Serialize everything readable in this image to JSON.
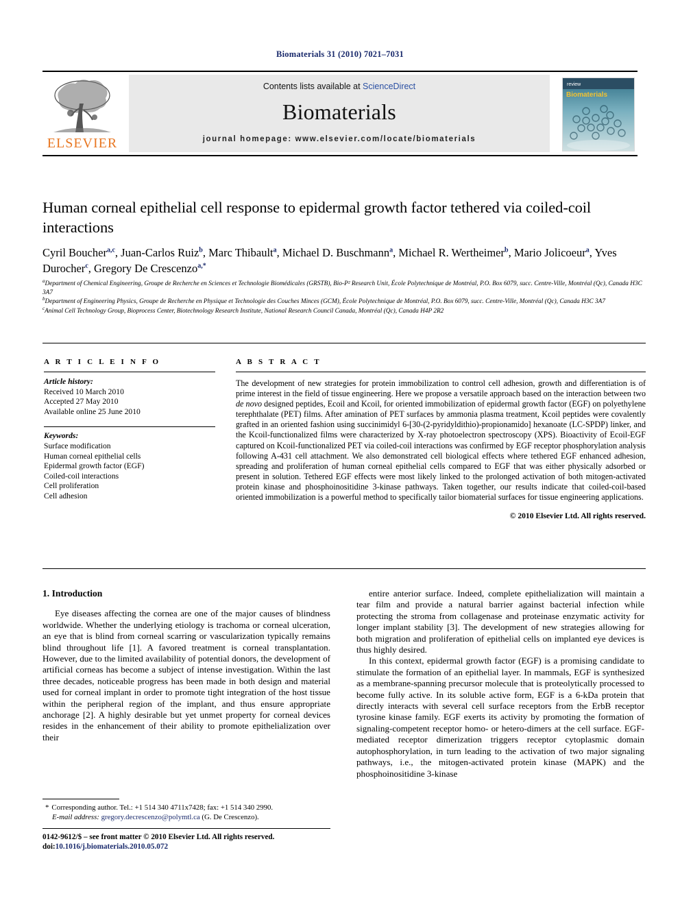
{
  "running_head": "Biomaterials 31 (2010) 7021–7031",
  "masthead": {
    "publisher_name": "ELSEVIER",
    "contents_prefix": "Contents lists available at ",
    "contents_link": "ScienceDirect",
    "journal_name": "Biomaterials",
    "homepage_label": "journal homepage: www.elsevier.com/locate/biomaterials",
    "cover_title": "Biomaterials",
    "link_color": "#2a4fa2",
    "brand_color": "#E87722"
  },
  "article": {
    "title": "Human corneal epithelial cell response to epidermal growth factor tethered via coiled-coil interactions",
    "authors_line1": "Cyril Boucher",
    "authors": [
      {
        "name": "Cyril Boucher",
        "sup": "a,c"
      },
      {
        "name": "Juan-Carlos Ruiz",
        "sup": "b"
      },
      {
        "name": "Marc Thibault",
        "sup": "a"
      },
      {
        "name": "Michael D. Buschmann",
        "sup": "a"
      },
      {
        "name": "Michael R. Wertheimer",
        "sup": "b"
      },
      {
        "name": "Mario Jolicoeur",
        "sup": "a"
      },
      {
        "name": "Yves Durocher",
        "sup": "c"
      },
      {
        "name": "Gregory De Crescenzo",
        "sup": "a,*"
      }
    ],
    "affiliations": [
      {
        "marker": "a",
        "text": "Department of Chemical Engineering, Groupe de Recherche en Sciences et Technologie Biomédicales (GRSTB), Bio-P² Research Unit, École Polytechnique de Montréal, P.O. Box 6079, succ. Centre-Ville, Montréal (Qc), Canada H3C 3A7"
      },
      {
        "marker": "b",
        "text": "Department of Engineering Physics, Groupe de Recherche en Physique et Technologie des Couches Minces (GCM), École Polytechnique de Montréal, P.O. Box 6079, succ. Centre-Ville, Montréal (Qc), Canada H3C 3A7"
      },
      {
        "marker": "c",
        "text": "Animal Cell Technology Group, Bioprocess Center, Biotechnology Research Institute, National Research Council Canada, Montréal (Qc), Canada H4P 2R2"
      }
    ]
  },
  "article_info": {
    "heading": "A R T I C L E   I N F O",
    "history_label": "Article history:",
    "history": [
      "Received 10 March 2010",
      "Accepted 27 May 2010",
      "Available online 25 June 2010"
    ],
    "keywords_label": "Keywords:",
    "keywords": [
      "Surface modification",
      "Human corneal epithelial cells",
      "Epidermal growth factor (EGF)",
      "Coiled-coil interactions",
      "Cell proliferation",
      "Cell adhesion"
    ]
  },
  "abstract": {
    "heading": "A B S T R A C T",
    "part1": "The development of new strategies for protein immobilization to control cell adhesion, growth and differentiation is of prime interest in the field of tissue engineering. Here we propose a versatile approach based on the interaction between two ",
    "italic1": "de novo",
    "part2": " designed peptides, Ecoil and Kcoil, for oriented immobilization of epidermal growth factor (EGF) on polyethylene terephthalate (PET) films. After amination of PET surfaces by ammonia plasma treatment, Kcoil peptides were covalently grafted in an oriented fashion using succinimidyl 6-[30-(2-pyridyldithio)-propionamido] hexanoate (LC-SPDP) linker, and the Kcoil-functionalized films were characterized by X-ray photoelectron spectroscopy (XPS). Bioactivity of Ecoil-EGF captured on Kcoil-functionalized PET via coiled-coil interactions was confirmed by EGF receptor phosphorylation analysis following A-431 cell attachment. We also demonstrated cell biological effects where tethered EGF enhanced adhesion, spreading and proliferation of human corneal epithelial cells compared to EGF that was either physically adsorbed or present in solution. Tethered EGF effects were most likely linked to the prolonged activation of both mitogen-activated protein kinase and phosphoinositidine 3-kinase pathways. Taken together, our results indicate that coiled-coil-based oriented immobilization is a powerful method to specifically tailor biomaterial surfaces for tissue engineering applications.",
    "copyright": "© 2010 Elsevier Ltd. All rights reserved."
  },
  "introduction": {
    "section_number_title": "1. Introduction",
    "left_paragraphs": [
      "Eye diseases affecting the cornea are one of the major causes of blindness worldwide. Whether the underlying etiology is trachoma or corneal ulceration, an eye that is blind from corneal scarring or vascularization typically remains blind throughout life [1]. A favored treatment is corneal transplantation. However, due to the limited availability of potential donors, the development of artificial corneas has become a subject of intense investigation. Within the last three decades, noticeable progress has been made in both design and material used for corneal implant in order to promote tight integration of the host tissue within the peripheral region of the implant, and thus ensure appropriate anchorage [2]. A highly desirable but yet unmet property for corneal devices resides in the enhancement of their ability to promote epithelialization over their"
    ],
    "right_paragraphs": [
      "entire anterior surface. Indeed, complete epithelialization will maintain a tear film and provide a natural barrier against bacterial infection while protecting the stroma from collagenase and proteinase enzymatic activity for longer implant stability [3]. The development of new strategies allowing for both migration and proliferation of epithelial cells on implanted eye devices is thus highly desired.",
      "In this context, epidermal growth factor (EGF) is a promising candidate to stimulate the formation of an epithelial layer. In mammals, EGF is synthesized as a membrane-spanning precursor molecule that is proteolytically processed to become fully active. In its soluble active form, EGF is a 6-kDa protein that directly interacts with several cell surface receptors from the ErbB receptor tyrosine kinase family. EGF exerts its activity by promoting the formation of signaling-competent receptor homo- or hetero-dimers at the cell surface. EGF-mediated receptor dimerization triggers receptor cytoplasmic domain autophosphorylation, in turn leading to the activation of two major signaling pathways, i.e., the mitogen-activated protein kinase (MAPK) and the phosphoinositidine 3-kinase"
    ]
  },
  "footnote": {
    "star": "*",
    "corresponding": "Corresponding author. Tel.: +1 514 340 4711x7428; fax: +1 514 340 2990.",
    "email_label": "E-mail address:",
    "email": "gregory.decrescenzo@polymtl.ca",
    "email_suffix": " (G. De Crescenzo)."
  },
  "front_matter": {
    "issn_line": "0142-9612/$ – see front matter © 2010 Elsevier Ltd. All rights reserved.",
    "doi_label": "doi:",
    "doi": "10.1016/j.biomaterials.2010.05.072"
  }
}
